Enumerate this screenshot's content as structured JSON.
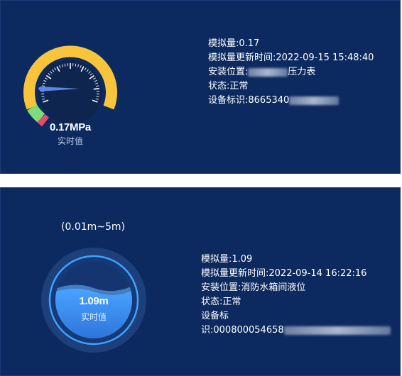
{
  "pressure_card": {
    "gauge_value": "0.17MPa",
    "gauge_caption": "实时值",
    "gauge_level_mpa": 0.17,
    "info": {
      "analog_value": "模拟量:0.17",
      "update_time": "模拟量更新时间:2022-09-15 15:48:40",
      "location_prefix": "安装位置:",
      "location_suffix": "压力表",
      "status": "状态:正常",
      "device_id": "设备标识:8665340"
    },
    "colors": {
      "arc_yellow": "#f7c43c",
      "arc_green": "#7fdc7a",
      "arc_red": "#e94b6a",
      "needle": "#5b86e5",
      "dial": "#0e2550"
    }
  },
  "level_card": {
    "range_label": "(0.01m~5m)",
    "gauge_value": "1.09m",
    "gauge_caption": "实时值",
    "fill_ratio": 0.218,
    "info": {
      "analog_value": "模拟量:1.09",
      "update_time": "模拟量更新时间:2022-09-14 16:22:16",
      "location": "安装位置:消防水箱间液位",
      "status": "状态:正常",
      "device_id_line1": "设备标",
      "device_id_line2": "识:000800054658"
    },
    "colors": {
      "ring": "#3ea2ff",
      "outer_disc": "#1d3f7a",
      "water": "#3a8ff0"
    }
  },
  "page": {
    "background": "#0c2a5f"
  }
}
